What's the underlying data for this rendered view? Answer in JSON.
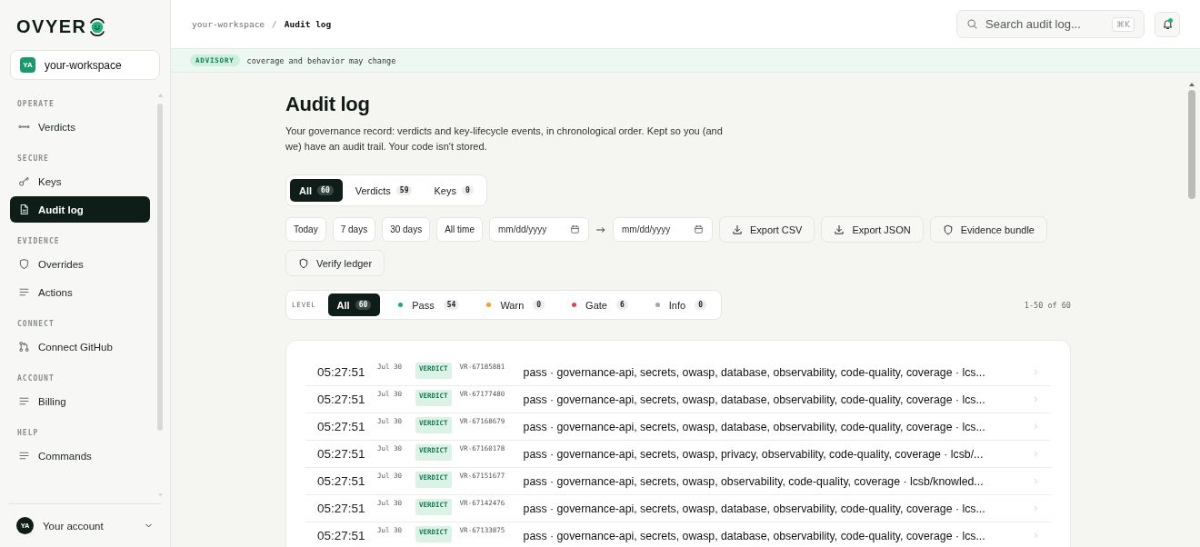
{
  "brand": {
    "logo": "OVYER"
  },
  "workspace": {
    "initials": "YA",
    "name": "your-workspace"
  },
  "sidebar": {
    "sections": [
      {
        "title": "OPERATE",
        "items": [
          {
            "label": "Verdicts",
            "kind": "verdicts",
            "selected": false
          }
        ]
      },
      {
        "title": "SECURE",
        "items": [
          {
            "label": "Keys",
            "kind": "key",
            "selected": false
          },
          {
            "label": "Audit log",
            "kind": "file",
            "selected": true
          }
        ]
      },
      {
        "title": "EVIDENCE",
        "items": [
          {
            "label": "Overrides",
            "kind": "shield",
            "selected": false
          },
          {
            "label": "Actions",
            "kind": "lines",
            "selected": false
          }
        ]
      },
      {
        "title": "CONNECT",
        "items": [
          {
            "label": "Connect GitHub",
            "kind": "git",
            "selected": false
          }
        ]
      },
      {
        "title": "ACCOUNT",
        "items": [
          {
            "label": "Billing",
            "kind": "lines",
            "selected": false
          }
        ]
      },
      {
        "title": "HELP",
        "items": [
          {
            "label": "Commands",
            "kind": "lines",
            "selected": false
          }
        ]
      }
    ]
  },
  "account": {
    "initials": "YA",
    "label": "Your account"
  },
  "breadcrumb": {
    "parent": "your-workspace",
    "separator": "/",
    "current": "Audit log"
  },
  "search": {
    "placeholder": "Search audit log...",
    "shortcut": "⌘K"
  },
  "notifications": {
    "unread": true
  },
  "advisory": {
    "badge": "ADVISORY",
    "text": "coverage and behavior may change"
  },
  "page": {
    "title": "Audit log",
    "description": "Your governance record: verdicts and key-lifecycle events, in chronological order. Kept so you (and we) have an audit trail. Your code isn't stored."
  },
  "tabs": [
    {
      "label": "All",
      "count": "60",
      "selected": true
    },
    {
      "label": "Verdicts",
      "count": "59",
      "selected": false
    },
    {
      "label": "Keys",
      "count": "0",
      "selected": false
    }
  ],
  "ranges": [
    {
      "label": "Today",
      "selected": false
    },
    {
      "label": "7 days",
      "selected": false
    },
    {
      "label": "30 days",
      "selected": false
    },
    {
      "label": "All time",
      "selected": false
    }
  ],
  "date_from": {
    "placeholder": "mm/dd/yyyy"
  },
  "date_to": {
    "placeholder": "mm/dd/yyyy"
  },
  "actions": [
    {
      "label": "Export CSV",
      "kind": "download"
    },
    {
      "label": "Export JSON",
      "kind": "download"
    },
    {
      "label": "Evidence bundle",
      "kind": "shield"
    },
    {
      "label": "Verify ledger",
      "kind": "shield"
    }
  ],
  "levels": {
    "label": "LEVEL",
    "items": [
      {
        "label": "All",
        "count": "60",
        "selected": true
      },
      {
        "label": "Pass",
        "count": "54",
        "selected": false,
        "color": "#1fa97a"
      },
      {
        "label": "Warn",
        "count": "0",
        "selected": false,
        "color": "#f0a020"
      },
      {
        "label": "Gate",
        "count": "6",
        "selected": false,
        "color": "#e04450"
      },
      {
        "label": "Info",
        "count": "0",
        "selected": false,
        "color": "#a0a4b8"
      }
    ]
  },
  "pagination": "1-50 of 60",
  "rows": [
    {
      "time": "05:27:51",
      "date": "Jul 30",
      "type": "VERDICT",
      "id": "VR-67185881",
      "summary": "pass · governance-api, secrets, owasp, database, observability, code-quality, coverage · lcs..."
    },
    {
      "time": "05:27:51",
      "date": "Jul 30",
      "type": "VERDICT",
      "id": "VR-67177480",
      "summary": "pass · governance-api, secrets, owasp, database, observability, code-quality, coverage · lcs..."
    },
    {
      "time": "05:27:51",
      "date": "Jul 30",
      "type": "VERDICT",
      "id": "VR-67168679",
      "summary": "pass · governance-api, secrets, owasp, database, observability, code-quality, coverage · lcs..."
    },
    {
      "time": "05:27:51",
      "date": "Jul 30",
      "type": "VERDICT",
      "id": "VR-67160178",
      "summary": "pass · governance-api, secrets, owasp, privacy, observability, code-quality, coverage · lcsb/..."
    },
    {
      "time": "05:27:51",
      "date": "Jul 30",
      "type": "VERDICT",
      "id": "VR-67151677",
      "summary": "pass · governance-api, secrets, owasp, observability, code-quality, coverage · lcsb/knowled..."
    },
    {
      "time": "05:27:51",
      "date": "Jul 30",
      "type": "VERDICT",
      "id": "VR-67142476",
      "summary": "pass · governance-api, secrets, owasp, database, observability, code-quality, coverage · lcs..."
    },
    {
      "time": "05:27:51",
      "date": "Jul 30",
      "type": "VERDICT",
      "id": "VR-67133875",
      "summary": "pass · governance-api, secrets, owasp, database, observability, code-quality, coverage · lcs..."
    }
  ]
}
